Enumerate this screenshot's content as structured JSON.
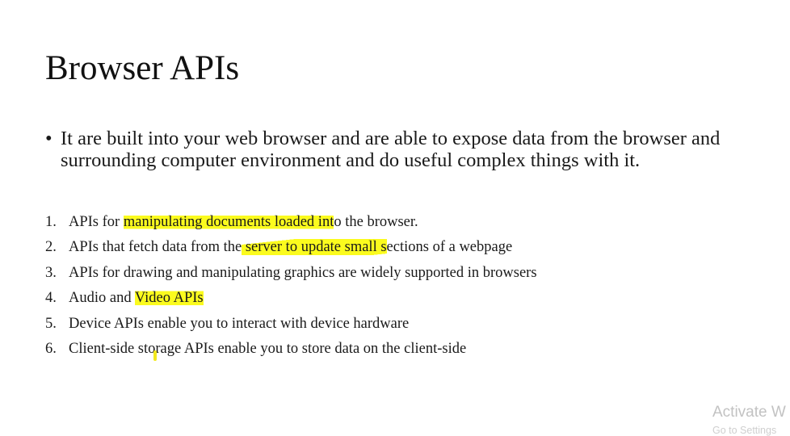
{
  "slide": {
    "title": "Browser APIs",
    "bullet": {
      "marker": "•",
      "text": "It are built into your web browser and are able to expose data from the browser and surrounding computer environment and do useful complex things with it."
    },
    "items": [
      {
        "number": "1.",
        "before": "APIs for ",
        "highlight": "manipulating documents loaded int",
        "after": "o the browser."
      },
      {
        "number": "2.",
        "before": "APIs that fetch data from the",
        "highlight": " server to update small s",
        "after": "ections of a webpage"
      },
      {
        "number": "3.",
        "before": "APIs for drawing and manipulating graphics are widely supported in browsers",
        "highlight": "",
        "after": ""
      },
      {
        "number": "4.",
        "before": "Audio and ",
        "highlight": "Video APIs",
        "after": ""
      },
      {
        "number": "5.",
        "before": "Device APIs enable you to interact with device hardware",
        "highlight": "",
        "after": ""
      },
      {
        "number": "6.",
        "before": "Client-side storage APIs enable you to store data on the client-side",
        "highlight": "",
        "after": ""
      }
    ],
    "highlight_color": "#ffff33"
  },
  "watermark": {
    "line1": "Activate W",
    "line2": "Go to Settings"
  }
}
